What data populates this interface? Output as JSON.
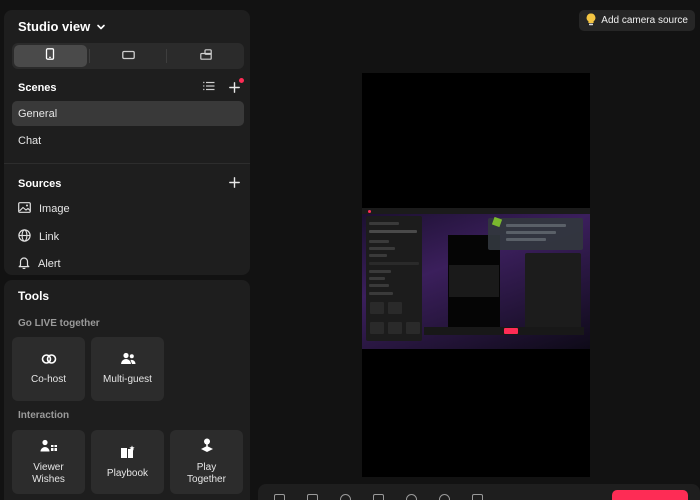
{
  "studio": {
    "title": "Studio view",
    "orientations": [
      "portrait-icon",
      "landscape-icon",
      "dual-icon"
    ],
    "active_orientation": "portrait"
  },
  "scenes": {
    "title": "Scenes",
    "items": [
      {
        "label": "General",
        "active": true
      },
      {
        "label": "Chat",
        "active": false
      }
    ]
  },
  "sources": {
    "title": "Sources",
    "items": [
      {
        "label": "Image",
        "icon": "image-icon"
      },
      {
        "label": "Link",
        "icon": "globe-icon"
      },
      {
        "label": "Alert",
        "icon": "bell-icon"
      }
    ]
  },
  "tools": {
    "title": "Tools",
    "go_live_together": {
      "title": "Go LIVE together",
      "items": [
        {
          "label": "Co-host",
          "icon": "link-rings-icon"
        },
        {
          "label": "Multi-guest",
          "icon": "people-icon"
        }
      ]
    },
    "interaction": {
      "title": "Interaction",
      "items": [
        {
          "label": "Viewer Wishes",
          "icon": "gift-people-icon"
        },
        {
          "label": "Playbook",
          "icon": "playbook-icon"
        },
        {
          "label": "Play Together",
          "icon": "play-together-icon"
        }
      ]
    }
  },
  "header": {
    "camera_button": "Add camera source",
    "camera_icon": "bulb-icon"
  },
  "colors": {
    "accent": "#fe2c55",
    "panel": "#1e1e1e",
    "background": "#121212"
  }
}
